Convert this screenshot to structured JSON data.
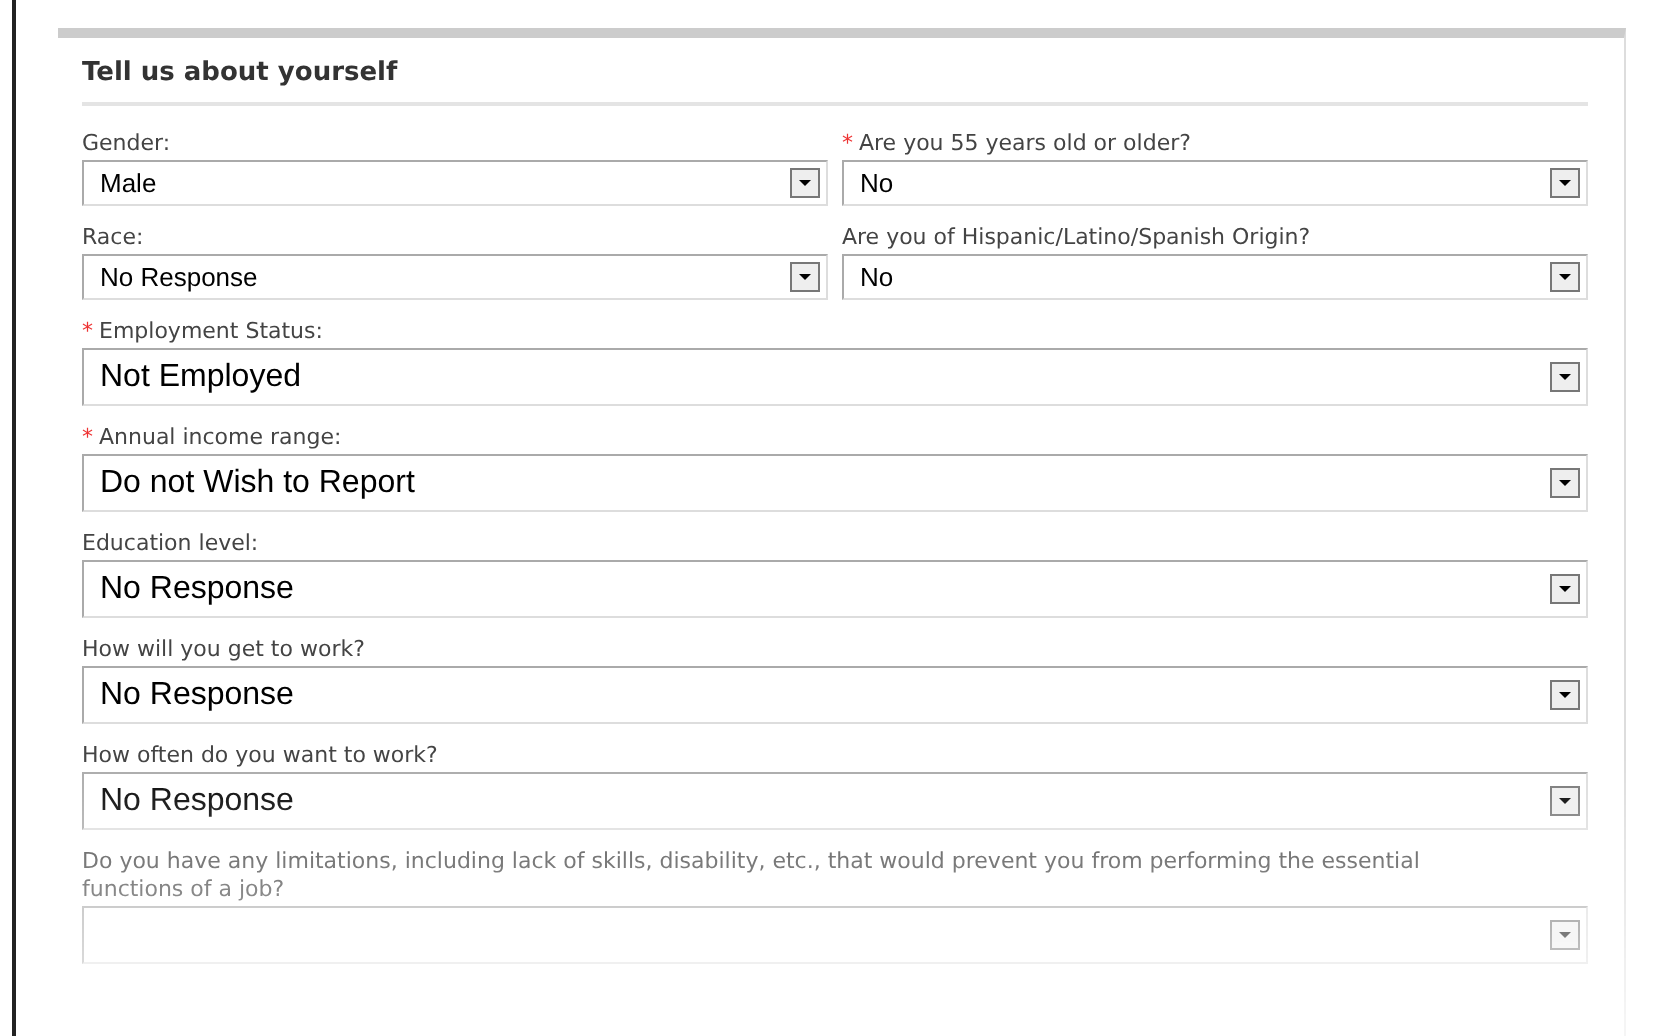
{
  "section": {
    "title": "Tell us about yourself"
  },
  "rows": [
    {
      "kind": "half",
      "fields": [
        {
          "label": "Gender:",
          "value": "Male"
        },
        {
          "mark": "*",
          "label": "Are you 55 years old or older?",
          "value": "No"
        }
      ]
    },
    {
      "kind": "half",
      "fields": [
        {
          "label": "Race:",
          "value": "No Response"
        },
        {
          "label": "Are you of Hispanic/Latino/Spanish Origin?",
          "value": "No"
        }
      ]
    },
    {
      "kind": "full",
      "fields": [
        {
          "mark": "*",
          "label": "Employment Status:",
          "value": "Not Employed"
        }
      ]
    },
    {
      "kind": "full",
      "fields": [
        {
          "mark": "*",
          "label": "Annual income range:",
          "value": "Do not Wish to Report"
        }
      ]
    },
    {
      "kind": "full",
      "fields": [
        {
          "label": "Education level:",
          "value": "No Response"
        }
      ]
    },
    {
      "kind": "full",
      "fields": [
        {
          "label": "How will you get to work?",
          "value": "No Response"
        }
      ]
    },
    {
      "kind": "full",
      "fields": [
        {
          "label": "How often do you want to work?",
          "value": "No Response"
        }
      ]
    },
    {
      "kind": "full",
      "fields": [
        {
          "label": "Do you have any limitations, including lack of skills, disability, etc., that would prevent you from performing the essential functions of a job?"
        }
      ]
    }
  ]
}
